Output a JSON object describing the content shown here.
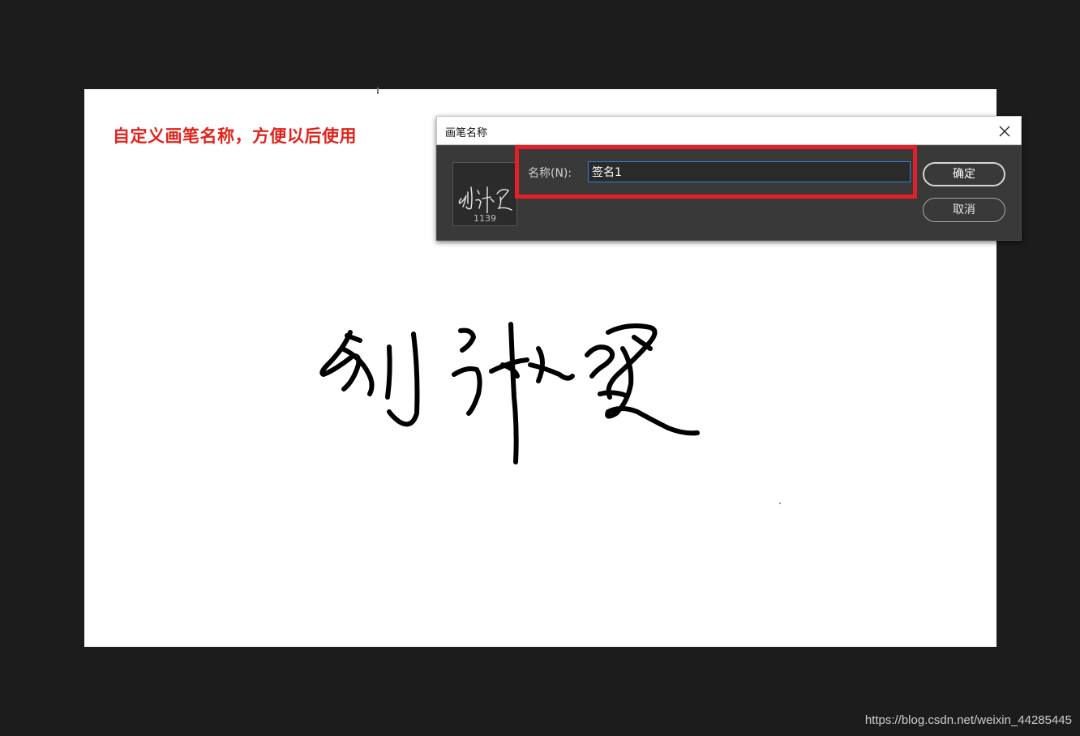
{
  "annotation": {
    "text": "自定义画笔名称，方便以后使用"
  },
  "dialog": {
    "title": "画笔名称",
    "brush_count": "1139",
    "name_label": "名称(N):",
    "name_value": "签名1",
    "ok_label": "确定",
    "cancel_label": "取消",
    "icons": {
      "close": "close-icon",
      "brush_tip": "signature-brush-icon"
    }
  },
  "watermark": "https://blog.csdn.net/weixin_44285445",
  "colors": {
    "annotation": "#e0231b",
    "highlight": "#e3202a",
    "dialog_bg": "#393939",
    "input_focus": "#2f7fd8",
    "workspace": "#1c1c1c"
  }
}
